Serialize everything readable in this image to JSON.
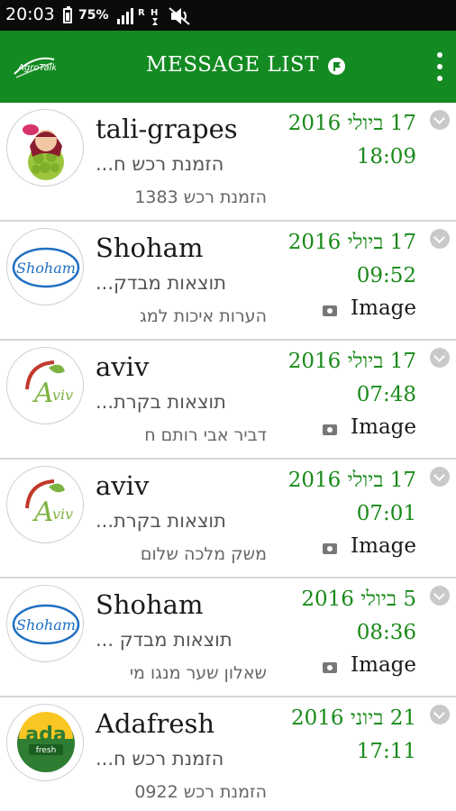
{
  "status_bar": {
    "time": "20:03",
    "battery": "75%",
    "icons": [
      "battery-icon",
      "signal-icon",
      "data-icon",
      "mute-icon"
    ]
  },
  "app_bar": {
    "logo_text": "AgroTalk",
    "title": "MESSAGE LIST",
    "color": "#148a22"
  },
  "messages": [
    {
      "name": "tali-grapes",
      "subject": "הזמנת רכש ח...",
      "preview": "הזמנת רכש 1383",
      "date": "17 ביולי 2016",
      "time": "18:09",
      "attachment": "",
      "avatar": "tali-grapes-avatar"
    },
    {
      "name": "Shoham",
      "subject": "תוצאות מבדק...",
      "preview": "הערות איכות למג",
      "date": "17 ביולי 2016",
      "time": "09:52",
      "attachment": "Image",
      "avatar": "shoham-logo"
    },
    {
      "name": "aviv",
      "subject": "תוצאות בקרת...",
      "preview": "דביר אבי רותם ח",
      "date": "17 ביולי 2016",
      "time": "07:48",
      "attachment": "Image",
      "avatar": "aviv-logo"
    },
    {
      "name": "aviv",
      "subject": "תוצאות בקרת...",
      "preview": "משק מלכה שלום",
      "date": "17 ביולי 2016",
      "time": "07:01",
      "attachment": "Image",
      "avatar": "aviv-logo"
    },
    {
      "name": "Shoham",
      "subject": "תוצאות מבדק ...",
      "preview": "שאלון שער מנגו מי",
      "date": "5 ביולי 2016",
      "time": "08:36",
      "attachment": "Image",
      "avatar": "shoham-logo"
    },
    {
      "name": "Adafresh",
      "subject": "הזמנת רכש ח...",
      "preview": "הזמנת רכש 0922",
      "date": "21 ביוני 2016",
      "time": "17:11",
      "attachment": "",
      "avatar": "adafresh-logo"
    }
  ]
}
